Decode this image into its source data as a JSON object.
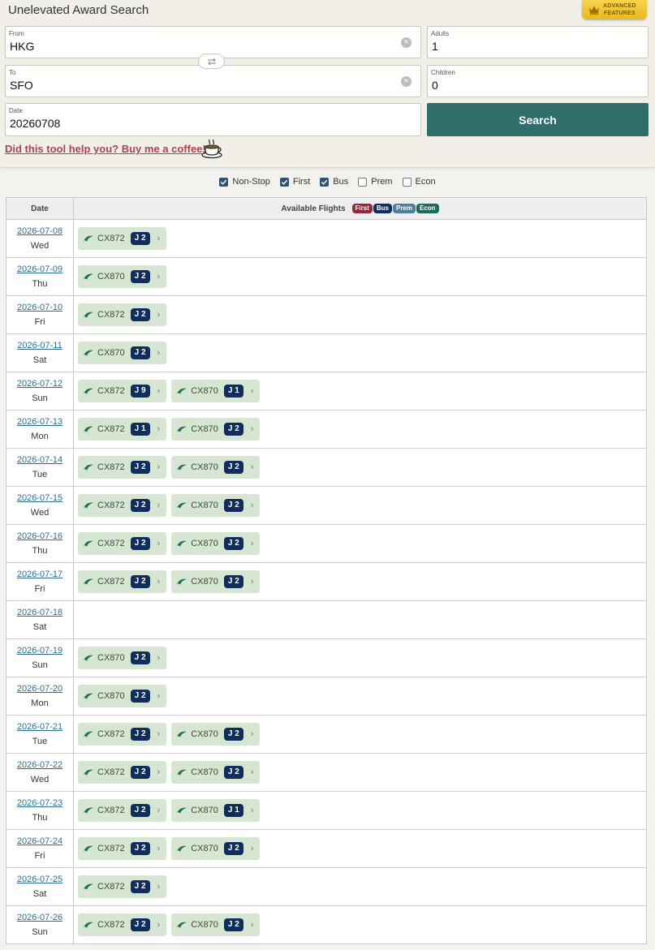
{
  "header": {
    "title": "Unelevated Award Search",
    "advanced_label_1": "ADVANCED",
    "advanced_label_2": "FEATURES",
    "advanced_icon": "crown-icon"
  },
  "form": {
    "from_label": "From",
    "from_value": "HKG",
    "to_label": "To",
    "to_value": "SFO",
    "date_label": "Date",
    "date_value": "20260708",
    "adults_label": "Adults",
    "adults_value": "1",
    "children_label": "Children",
    "children_value": "0",
    "search_label": "Search",
    "coffee_link": "Did this tool help you? Buy me a coffee!"
  },
  "filters": [
    {
      "label": "Non-Stop",
      "checked": true
    },
    {
      "label": "First",
      "checked": true
    },
    {
      "label": "Bus",
      "checked": true
    },
    {
      "label": "Prem",
      "checked": false
    },
    {
      "label": "Econ",
      "checked": false
    }
  ],
  "table": {
    "col_date": "Date",
    "col_available": "Available Flights",
    "legend": [
      {
        "label": "First",
        "color": "#8e2c3b"
      },
      {
        "label": "Bus",
        "color": "#102e5c"
      },
      {
        "label": "Prem",
        "color": "#4f7f99"
      },
      {
        "label": "Econ",
        "color": "#1f6b5b"
      }
    ],
    "rows": [
      {
        "date": "2026-07-08",
        "dow": "Wed",
        "flights": [
          {
            "no": "CX872",
            "cls": "J 2"
          }
        ]
      },
      {
        "date": "2026-07-09",
        "dow": "Thu",
        "flights": [
          {
            "no": "CX870",
            "cls": "J 2"
          }
        ]
      },
      {
        "date": "2026-07-10",
        "dow": "Fri",
        "flights": [
          {
            "no": "CX872",
            "cls": "J 2"
          }
        ]
      },
      {
        "date": "2026-07-11",
        "dow": "Sat",
        "flights": [
          {
            "no": "CX870",
            "cls": "J 2"
          }
        ]
      },
      {
        "date": "2026-07-12",
        "dow": "Sun",
        "flights": [
          {
            "no": "CX872",
            "cls": "J 9"
          },
          {
            "no": "CX870",
            "cls": "J 1"
          }
        ]
      },
      {
        "date": "2026-07-13",
        "dow": "Mon",
        "flights": [
          {
            "no": "CX872",
            "cls": "J 1"
          },
          {
            "no": "CX870",
            "cls": "J 2"
          }
        ]
      },
      {
        "date": "2026-07-14",
        "dow": "Tue",
        "flights": [
          {
            "no": "CX872",
            "cls": "J 2"
          },
          {
            "no": "CX870",
            "cls": "J 2"
          }
        ]
      },
      {
        "date": "2026-07-15",
        "dow": "Wed",
        "flights": [
          {
            "no": "CX872",
            "cls": "J 2"
          },
          {
            "no": "CX870",
            "cls": "J 2"
          }
        ]
      },
      {
        "date": "2026-07-16",
        "dow": "Thu",
        "flights": [
          {
            "no": "CX872",
            "cls": "J 2"
          },
          {
            "no": "CX870",
            "cls": "J 2"
          }
        ]
      },
      {
        "date": "2026-07-17",
        "dow": "Fri",
        "flights": [
          {
            "no": "CX872",
            "cls": "J 2"
          },
          {
            "no": "CX870",
            "cls": "J 2"
          }
        ]
      },
      {
        "date": "2026-07-18",
        "dow": "Sat",
        "flights": []
      },
      {
        "date": "2026-07-19",
        "dow": "Sun",
        "flights": [
          {
            "no": "CX870",
            "cls": "J 2"
          }
        ]
      },
      {
        "date": "2026-07-20",
        "dow": "Mon",
        "flights": [
          {
            "no": "CX870",
            "cls": "J 2"
          }
        ]
      },
      {
        "date": "2026-07-21",
        "dow": "Tue",
        "flights": [
          {
            "no": "CX872",
            "cls": "J 2"
          },
          {
            "no": "CX870",
            "cls": "J 2"
          }
        ]
      },
      {
        "date": "2026-07-22",
        "dow": "Wed",
        "flights": [
          {
            "no": "CX872",
            "cls": "J 2"
          },
          {
            "no": "CX870",
            "cls": "J 2"
          }
        ]
      },
      {
        "date": "2026-07-23",
        "dow": "Thu",
        "flights": [
          {
            "no": "CX872",
            "cls": "J 2"
          },
          {
            "no": "CX870",
            "cls": "J 1"
          }
        ]
      },
      {
        "date": "2026-07-24",
        "dow": "Fri",
        "flights": [
          {
            "no": "CX872",
            "cls": "J 2"
          },
          {
            "no": "CX870",
            "cls": "J 2"
          }
        ]
      },
      {
        "date": "2026-07-25",
        "dow": "Sat",
        "flights": [
          {
            "no": "CX872",
            "cls": "J 2"
          }
        ]
      },
      {
        "date": "2026-07-26",
        "dow": "Sun",
        "flights": [
          {
            "no": "CX872",
            "cls": "J 2"
          },
          {
            "no": "CX870",
            "cls": "J 2"
          }
        ]
      }
    ]
  }
}
